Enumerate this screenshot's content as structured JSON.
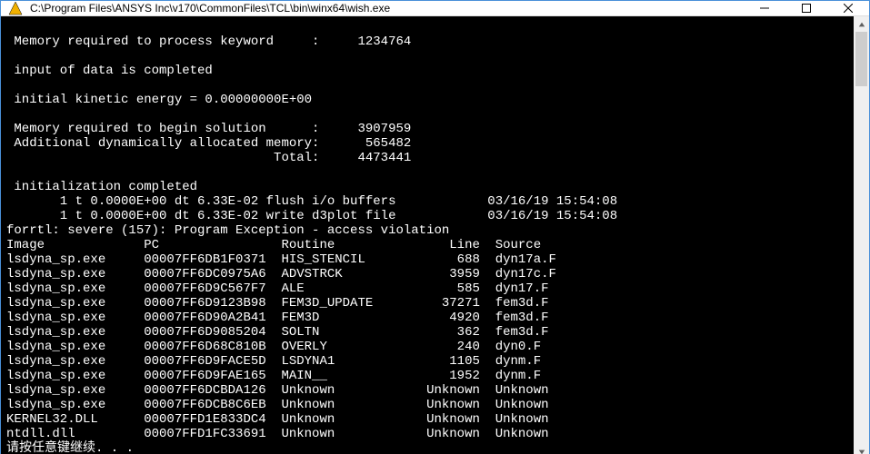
{
  "window": {
    "title": "C:\\Program Files\\ANSYS Inc\\v170\\CommonFiles\\TCL\\bin\\winx64\\wish.exe",
    "icon_name": "ansys-app-icon",
    "controls": {
      "minimize": "minimize",
      "maximize": "maximize",
      "close": "close"
    }
  },
  "console": {
    "lines": [
      "",
      " Memory required to process keyword     :     1234764",
      "",
      " input of data is completed",
      "",
      " initial kinetic energy = 0.00000000E+00",
      "",
      " Memory required to begin solution      :     3907959",
      " Additional dynamically allocated memory:      565482",
      "                                   Total:     4473441",
      "",
      " initialization completed",
      "       1 t 0.0000E+00 dt 6.33E-02 flush i/o buffers            03/16/19 15:54:08",
      "       1 t 0.0000E+00 dt 6.33E-02 write d3plot file            03/16/19 15:54:08",
      "forrtl: severe (157): Program Exception - access violation"
    ],
    "trace": {
      "headers": [
        "Image",
        "PC",
        "Routine",
        "Line",
        "Source"
      ],
      "rows": [
        [
          "lsdyna_sp.exe",
          "00007FF6DB1F0371",
          "HIS_STENCIL",
          "688",
          "dyn17a.F"
        ],
        [
          "lsdyna_sp.exe",
          "00007FF6DC0975A6",
          "ADVSTRCK",
          "3959",
          "dyn17c.F"
        ],
        [
          "lsdyna_sp.exe",
          "00007FF6D9C567F7",
          "ALE",
          "585",
          "dyn17.F"
        ],
        [
          "lsdyna_sp.exe",
          "00007FF6D9123B98",
          "FEM3D_UPDATE",
          "37271",
          "fem3d.F"
        ],
        [
          "lsdyna_sp.exe",
          "00007FF6D90A2B41",
          "FEM3D",
          "4920",
          "fem3d.F"
        ],
        [
          "lsdyna_sp.exe",
          "00007FF6D9085204",
          "SOLTN",
          "362",
          "fem3d.F"
        ],
        [
          "lsdyna_sp.exe",
          "00007FF6D68C810B",
          "OVERLY",
          "240",
          "dyn0.F"
        ],
        [
          "lsdyna_sp.exe",
          "00007FF6D9FACE5D",
          "LSDYNA1",
          "1105",
          "dynm.F"
        ],
        [
          "lsdyna_sp.exe",
          "00007FF6D9FAE165",
          "MAIN__",
          "1952",
          "dynm.F"
        ],
        [
          "lsdyna_sp.exe",
          "00007FF6DCBDA126",
          "Unknown",
          "Unknown",
          "Unknown"
        ],
        [
          "lsdyna_sp.exe",
          "00007FF6DCB8C6EB",
          "Unknown",
          "Unknown",
          "Unknown"
        ],
        [
          "KERNEL32.DLL",
          "00007FFD1E833DC4",
          "Unknown",
          "Unknown",
          "Unknown"
        ],
        [
          "ntdll.dll",
          "00007FFD1FC33691",
          "Unknown",
          "Unknown",
          "Unknown"
        ]
      ]
    },
    "footer": "请按任意键继续. . ."
  },
  "table_widths": {
    "image": 18,
    "pc": 18,
    "routine": 14,
    "line": 12,
    "source": 0
  }
}
